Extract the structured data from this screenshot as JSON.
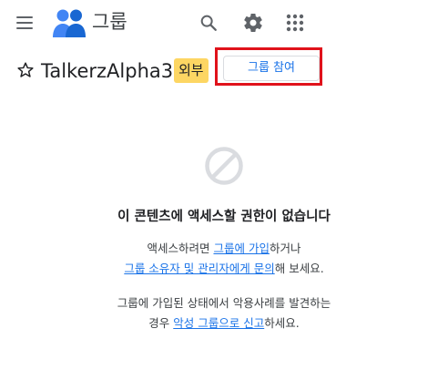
{
  "app": {
    "title": "그룹"
  },
  "group": {
    "name": "TalkerzAlpha3",
    "badge": "외부",
    "join_label": "그룹 참여"
  },
  "message": {
    "title": "이 콘텐츠에 액세스할 권한이 없습니다",
    "line1_prefix": "액세스하려면 ",
    "line1_link1": "그룹에 가입",
    "line1_suffix": "하거나",
    "line2_link": "그룹 소유자 및 관리자에게 문의",
    "line2_suffix": "해 보세요.",
    "line3": "그룹에 가입된 상태에서 악용사례를 발견하는",
    "line4_prefix": "경우 ",
    "line4_link": "악성 그룹으로 신고",
    "line4_suffix": "하세요."
  },
  "icons": {
    "menu": "hamburger-menu-icon",
    "logo": "groups-logo-icon",
    "search": "search-icon",
    "settings": "gear-icon",
    "apps": "apps-grid-icon",
    "star": "star-outline-icon",
    "blocked": "blocked-icon"
  },
  "colors": {
    "brand_blue": "#1a73e8",
    "logo_blue_dark": "#1967d2",
    "logo_blue_light": "#4285f4",
    "badge_yellow": "#fdd663",
    "highlight_red": "#e0121b",
    "icon_grey": "#5f6368",
    "blocked_grey": "#dadce0"
  }
}
